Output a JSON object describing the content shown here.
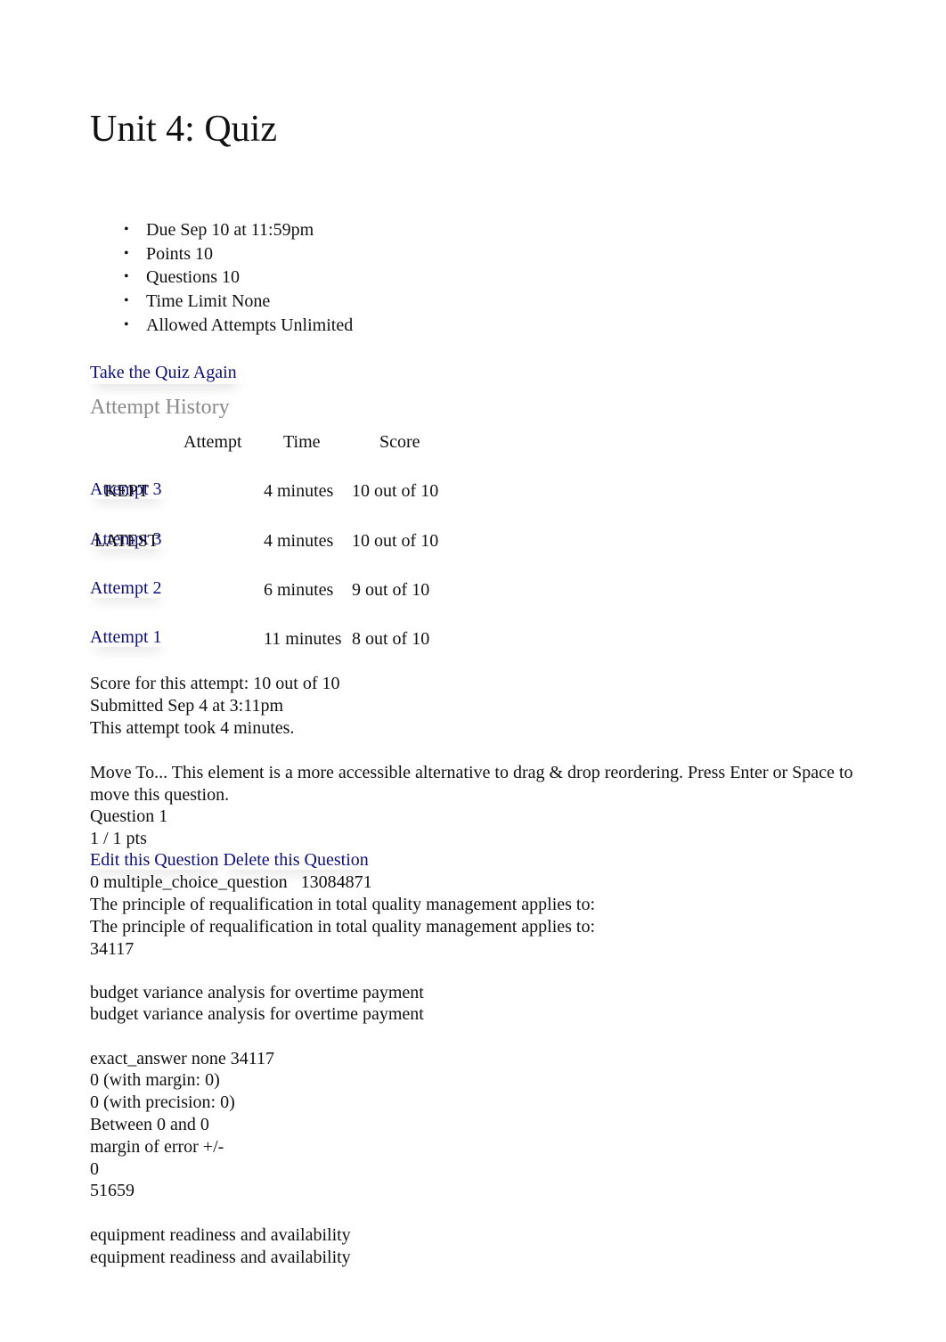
{
  "page_title": "Unit 4: Quiz",
  "details": [
    "Due Sep 10 at 11:59pm",
    "Points 10",
    "Questions 10",
    "Time Limit None",
    "Allowed Attempts Unlimited"
  ],
  "take_again_label": "Take the Quiz Again",
  "attempt_history": {
    "title": "Attempt History",
    "headers": {
      "attempt": "Attempt",
      "time": "Time",
      "score": "Score"
    },
    "rows": [
      {
        "flag": "KEPT",
        "attempt": "Attempt 3",
        "time": "4 minutes",
        "score": "10 out of 10"
      },
      {
        "flag": "LATEST",
        "attempt": "Attempt 3",
        "time": "4 minutes",
        "score": "10 out of 10"
      },
      {
        "flag": "",
        "attempt": "Attempt 2",
        "time": "6 minutes",
        "score": "9 out of 10"
      },
      {
        "flag": "",
        "attempt": "Attempt 1",
        "time": "11 minutes",
        "score": "8 out of 10"
      }
    ]
  },
  "summary": {
    "score": "Score for this attempt: 10 out of 10",
    "submitted": "Submitted Sep 4 at 3:11pm",
    "duration": "This attempt took 4 minutes."
  },
  "question": {
    "move_to": "Move To... This element is a more accessible alternative to drag & drop reordering. Press Enter or Space to move this question.",
    "name": "Question 1",
    "points": "1 / 1 pts",
    "edit_label": "Edit this Question",
    "delete_label": "Delete this Question",
    "meta": "0 multiple_choice_question   13084871",
    "text_1": "The principle of requalification in total quality management applies to:",
    "text_2": "The principle of requalification in total quality management applies to:",
    "answer_id_1": "34117",
    "answer_1_text_a": "budget variance analysis for overtime payment",
    "answer_1_text_b": "budget variance analysis for overtime payment",
    "exact_answer": "exact_answer none 34117",
    "with_margin": "0 (with margin: 0)",
    "with_precision": "0 (with precision: 0)",
    "between": "Between 0 and 0",
    "margin_of_error": "margin of error +/-",
    "margin_value": "0",
    "answer_id_2": "51659",
    "answer_2_text_a": "equipment readiness and availability",
    "answer_2_text_b": "equipment readiness and availability"
  }
}
